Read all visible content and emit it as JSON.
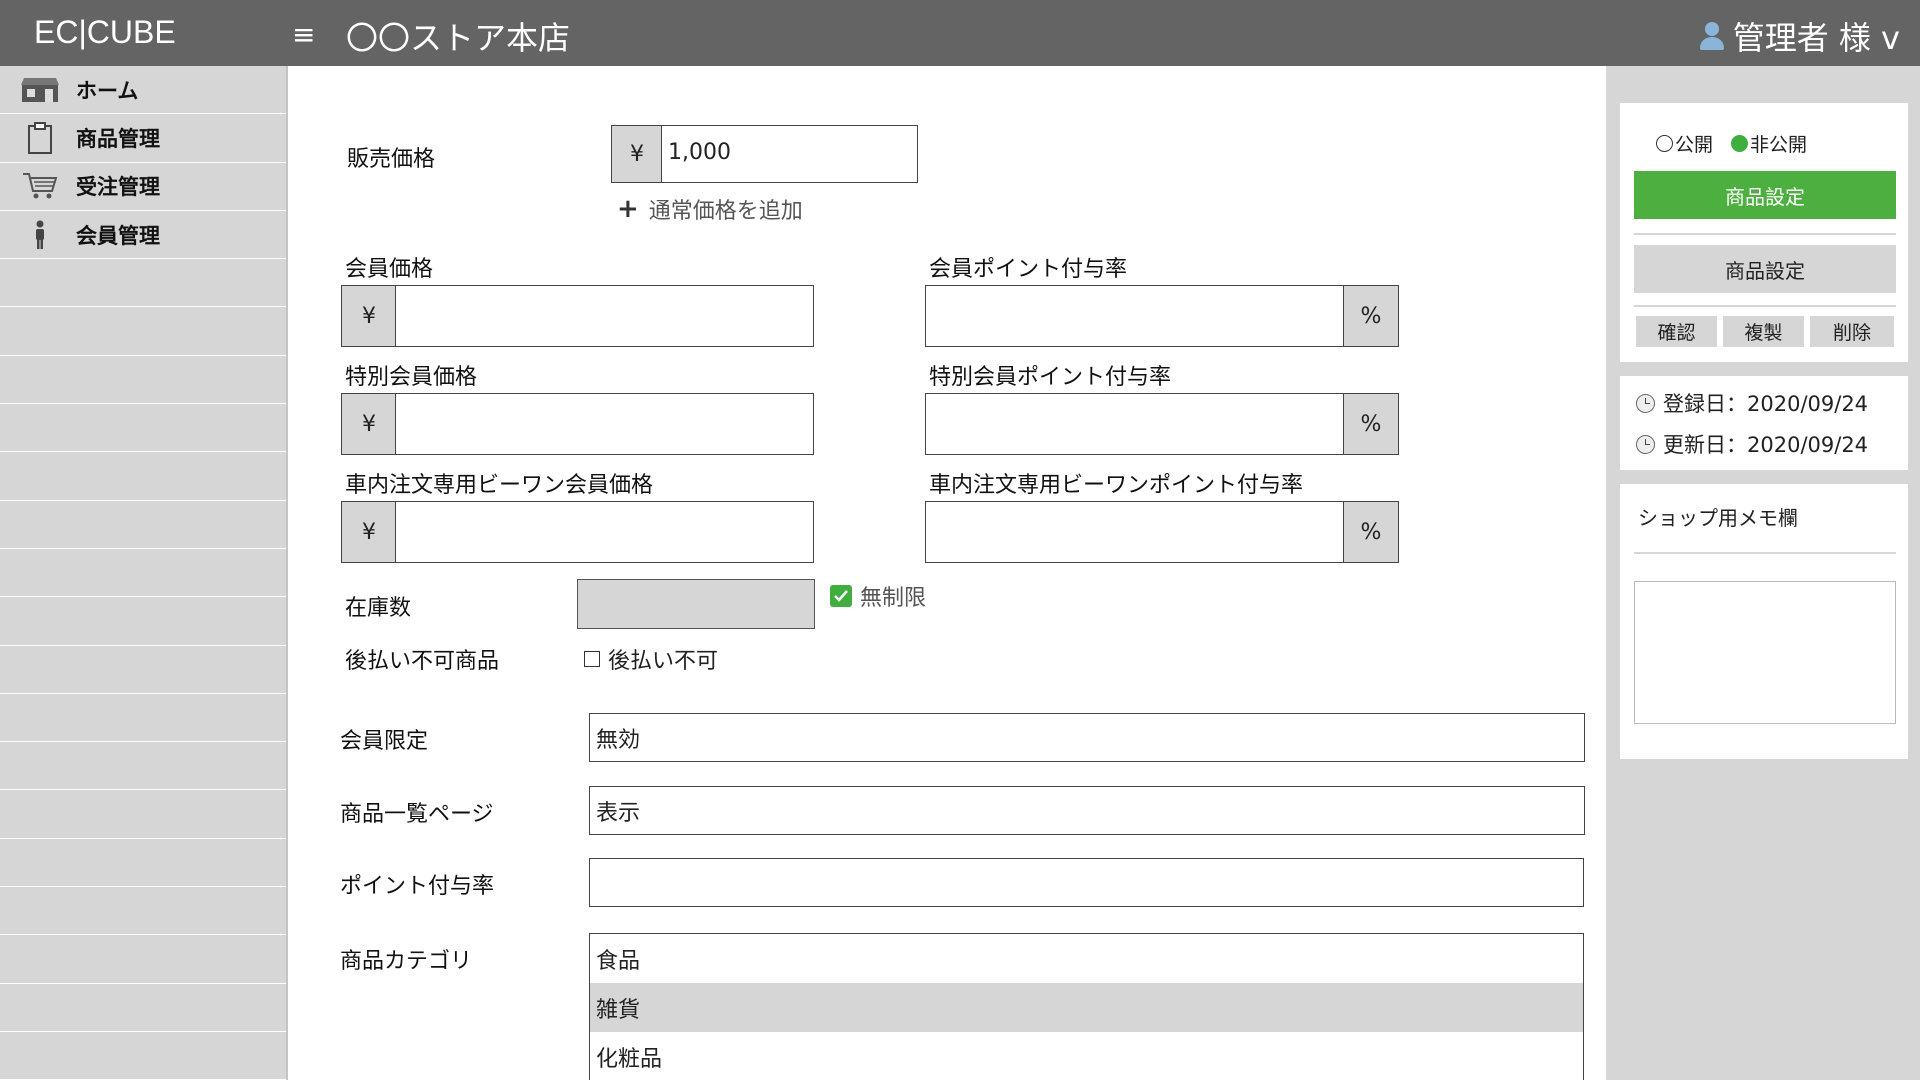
{
  "header": {
    "logo": "EC|CUBE",
    "menu_icon": "≡",
    "store_name": "〇〇ストア本店",
    "user_label": "管理者 様 v"
  },
  "sidebar": {
    "items": [
      {
        "label": "ホーム",
        "icon": "store-icon"
      },
      {
        "label": "商品管理",
        "icon": "clipboard-icon"
      },
      {
        "label": "受注管理",
        "icon": "cart-icon"
      },
      {
        "label": "会員管理",
        "icon": "person-icon"
      }
    ]
  },
  "form": {
    "sale_price": {
      "label": "販売価格",
      "currency": "¥",
      "value": "1,000"
    },
    "add_regular_price": {
      "plus": "+",
      "label": "通常価格を追加"
    },
    "member_price": {
      "label": "会員価格",
      "currency": "¥",
      "value": ""
    },
    "member_point_rate": {
      "label": "会員ポイント付与率",
      "unit": "%",
      "value": ""
    },
    "special_member_price": {
      "label": "特別会員価格",
      "currency": "¥",
      "value": ""
    },
    "special_member_point_rate": {
      "label": "特別会員ポイント付与率",
      "unit": "%",
      "value": ""
    },
    "beone_member_price": {
      "label": "車内注文専用ビーワン会員価格",
      "currency": "¥",
      "value": ""
    },
    "beone_point_rate": {
      "label": "車内注文専用ビーワンポイント付与率",
      "unit": "%",
      "value": ""
    },
    "stock": {
      "label": "在庫数",
      "value": "",
      "unlimited_label": "無制限",
      "unlimited_checked": true
    },
    "deferred": {
      "label": "後払い不可商品",
      "checkbox_label": "後払い不可",
      "checked": false
    },
    "member_limit": {
      "label": "会員限定",
      "value": "無効"
    },
    "list_page": {
      "label": "商品一覧ページ",
      "value": "表示"
    },
    "point_rate": {
      "label": "ポイント付与率",
      "value": ""
    },
    "category": {
      "label": "商品カテゴリ",
      "options": [
        "食品",
        "雑貨",
        "化粧品"
      ],
      "selected_index": 1
    }
  },
  "right_panel": {
    "visibility": {
      "public_label": "公開",
      "private_label": "非公開",
      "selected": "private"
    },
    "primary_button": "商品設定",
    "secondary_button": "商品設定",
    "actions": [
      "確認",
      "複製",
      "削除"
    ],
    "registered": {
      "label": "登録日：2020/09/24"
    },
    "updated": {
      "label": "更新日：2020/09/24"
    },
    "memo": {
      "label": "ショップ用メモ欄",
      "value": ""
    }
  },
  "colors": {
    "header_bg": "#646464",
    "sidebar_bg": "#d6d6d6",
    "accent_green": "#4caf3f"
  }
}
